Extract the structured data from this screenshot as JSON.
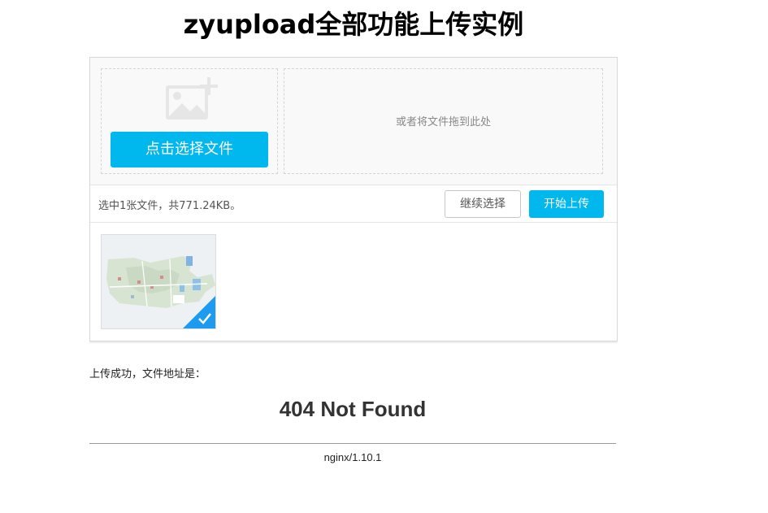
{
  "header": {
    "title": "zyupload全部功能上传实例"
  },
  "uploader": {
    "choose_button_label": "点击选择文件",
    "drop_hint": "或者将文件拖到此处",
    "status_text": "选中1张文件，共771.24KB。",
    "continue_button_label": "继续选择",
    "start_button_label": "开始上传",
    "files": [
      {
        "thumbnail_icon": "map-image",
        "status": "success",
        "status_icon": "checkmark-icon"
      }
    ],
    "colors": {
      "accent": "#00b7ee",
      "success_corner": "#1c9bf0"
    }
  },
  "result": {
    "label": "上传成功，文件地址是：",
    "error_heading": "404 Not Found",
    "server_footer": "nginx/1.10.1"
  }
}
